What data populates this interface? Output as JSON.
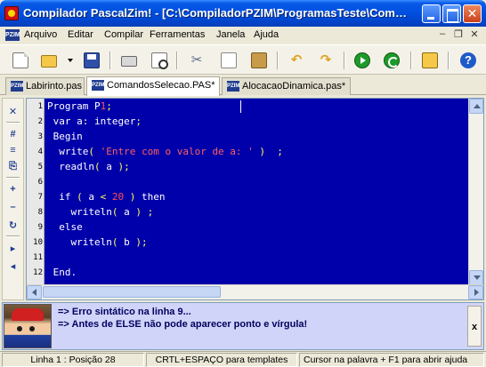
{
  "window": {
    "title": "Compilador PascalZim! - [C:\\CompiladorPZIM\\ProgramasTeste\\Comand...",
    "min_label": "",
    "max_label": "",
    "close_label": "✕"
  },
  "menu": {
    "app_icon_text": "PZIM",
    "items": [
      "Arquivo",
      "Editar",
      "Compilar",
      "Ferramentas",
      "Janela",
      "Ajuda"
    ],
    "mdi_controls": [
      "–",
      "❐",
      "✕"
    ]
  },
  "toolbar": {
    "icons": [
      "new-file-icon",
      "open-folder-icon",
      "dropdown-arrow-icon",
      "save-icon",
      "print-icon",
      "print-preview-icon",
      "cut-icon",
      "copy-icon",
      "paste-icon",
      "undo-icon",
      "redo-icon",
      "run-icon",
      "step-icon",
      "settings-icon",
      "help-icon"
    ],
    "help_glyph": "?"
  },
  "tabs": [
    {
      "label": "Labirinto.pas",
      "icon_text": "PZIM",
      "active": false
    },
    {
      "label": "ComandosSelecao.PAS*",
      "icon_text": "PZIM",
      "active": true
    },
    {
      "label": "AlocacaoDinamica.pas*",
      "icon_text": "PZIM",
      "active": false
    }
  ],
  "left_tools": [
    "✕",
    "#",
    "≡",
    "⎘",
    "+",
    "–",
    "↻",
    "▸",
    "◂"
  ],
  "editor": {
    "line_numbers": [
      "1",
      "2",
      "3",
      "4",
      "5",
      "6",
      "7",
      "8",
      "9",
      "10",
      "11",
      "12"
    ],
    "lines": [
      "Program P1;",
      " var a: integer;",
      " Begin",
      "  write( 'Entre com o valor de a: ' )  ;",
      "  readln( a );",
      "",
      "  if ( a < 20 ) then",
      "    writeln( a ) ;",
      "  else",
      "    writeln( b );",
      "",
      " End."
    ]
  },
  "messages": {
    "line1": "=> Erro sintático na linha 9...",
    "line2": "=> Antes de ELSE não pode aparecer ponto e vírgula!",
    "close_label": "x"
  },
  "status": {
    "position": "Linha 1 : Posição 28",
    "templates": "CRTL+ESPAÇO para templates",
    "help": "Cursor na palavra + F1 para abrir ajuda"
  },
  "colors": {
    "editor_bg": "#0000AA",
    "editor_text": "#FFFFFF",
    "string_color": "#FF6060",
    "message_bg": "#D0D4F8"
  }
}
